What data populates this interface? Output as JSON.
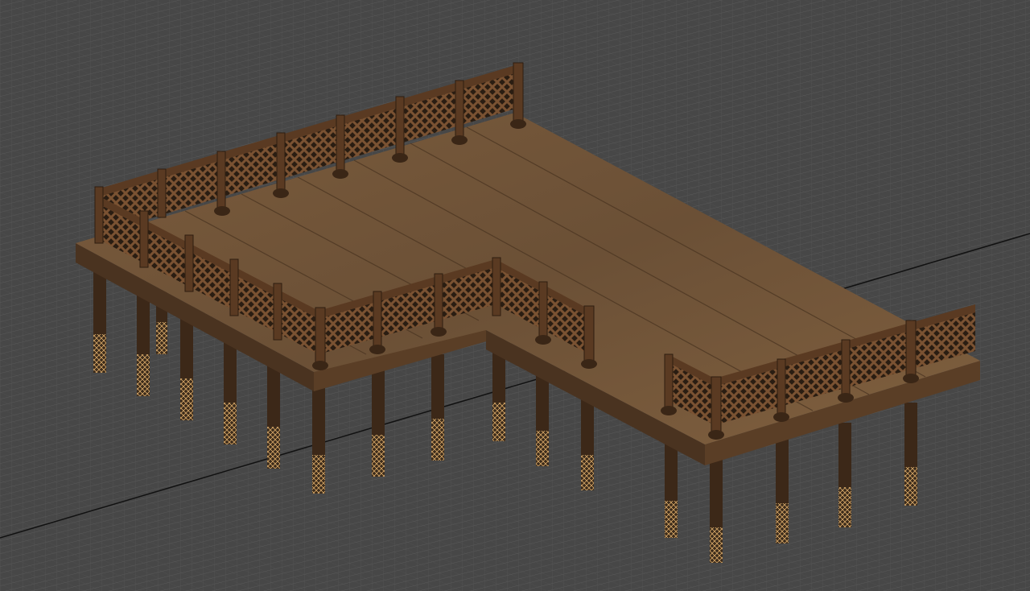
{
  "viewport": {
    "background": "#474747",
    "grid_line_color": "#5a5a5a",
    "world_axis_color": "#111111"
  },
  "model": {
    "deck_color": "#6e5338",
    "deck_edge_color": "#4a3320",
    "railing_color": "#5a3a22",
    "railing_shadow_color": "#2e1d10",
    "lattice_color": "#7a5232",
    "post_color": "#3c2818",
    "wire_color": "#d8a868"
  }
}
